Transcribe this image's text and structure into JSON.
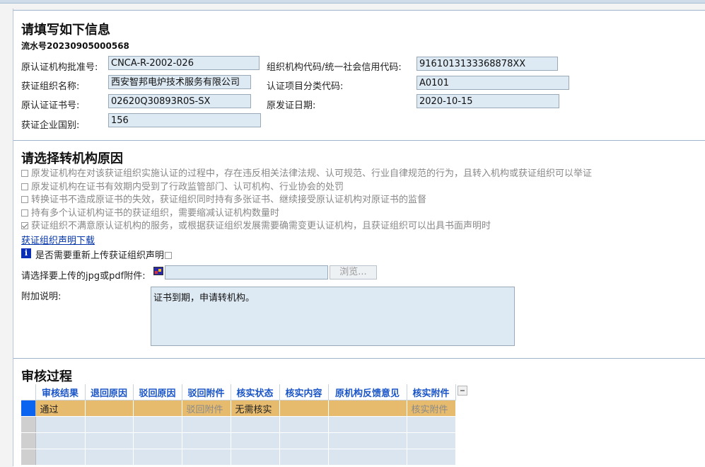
{
  "info_section": {
    "title": "请填写如下信息",
    "serial": "流水号20230905000568",
    "fields": {
      "orig_approval_label": "原认证机构批准号:",
      "orig_approval_value": "CNCA-R-2002-026",
      "org_code_label": "组织机构代码/统一社会信用代码:",
      "org_code_value": "9161013133368878XX",
      "org_name_label": "获证组织名称:",
      "org_name_value": "西安智邦电炉技术服务有限公司",
      "category_label": "认证项目分类代码:",
      "category_value": "A0101",
      "cert_no_label": "原认证证书号:",
      "cert_no_value": "02620Q30893R0S-SX",
      "issue_date_label": "原发证日期:",
      "issue_date_value": "2020-10-15",
      "country_label": "获证企业国别:",
      "country_value": "156"
    }
  },
  "reason_section": {
    "title": "请选择转机构原因",
    "options": [
      {
        "text": "原发证机构在对该获证组织实施认证的过程中，存在违反相关法律法规、认可规范、行业自律规范的行为，且转入机构或获证组织可以举证",
        "checked": false
      },
      {
        "text": "原发证机构在证书有效期内受到了行政监管部门、认可机构、行业协会的处罚",
        "checked": false
      },
      {
        "text": "转换证书不造成原证书的失效，获证组织同时持有多张证书、继续接受原认证机构对原证书的监督",
        "checked": false
      },
      {
        "text": "持有多个认证机构证书的获证组织，需要缩减认证机构数量时",
        "checked": false
      },
      {
        "text": "获证组织不满意原认证机构的服务，或根据获证组织发展需要确需变更认证机构，且获证组织可以出具书面声明时",
        "checked": true
      }
    ],
    "download_link": "获证组织声明下载",
    "reupload_label": "是否需要重新上传获证组织声明",
    "upload_label": "请选择要上传的jpg或pdf附件:",
    "browse_label": "浏览...",
    "note_label": "附加说明:",
    "note_value": "证书到期，申请转机构。"
  },
  "review_section": {
    "title": "审核过程",
    "columns": [
      "审核结果",
      "退回原因",
      "驳回原因",
      "驳回附件",
      "核实状态",
      "核实内容",
      "原机构反馈意见",
      "核实附件"
    ],
    "rows": [
      [
        "通过",
        "",
        "",
        "驳回附件",
        "无需核实",
        "",
        "",
        "核实附件"
      ],
      [
        "",
        "",
        "",
        "",
        "",
        "",
        "",
        ""
      ],
      [
        "",
        "",
        "",
        "",
        "",
        "",
        "",
        ""
      ],
      [
        "",
        "",
        "",
        "",
        "",
        "",
        "",
        ""
      ]
    ]
  },
  "colors": {
    "accent": "#1a55c8",
    "selected_row": "#e6bb6d",
    "field_bg": "#dde9f3"
  }
}
